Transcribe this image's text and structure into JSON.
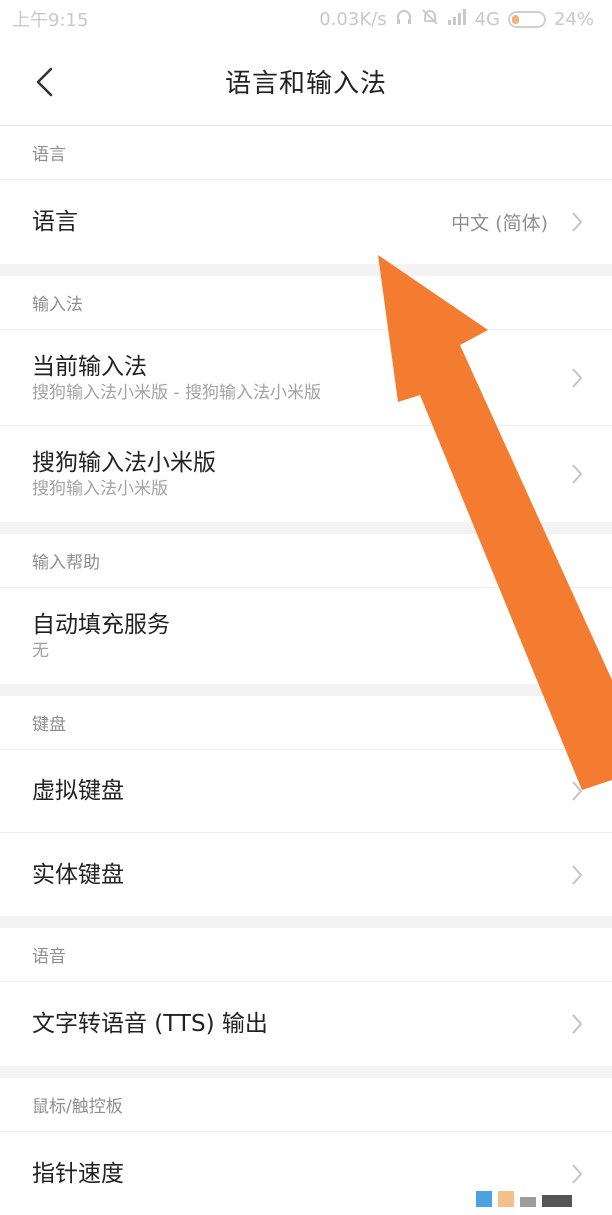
{
  "status_bar": {
    "time": "上午9:15",
    "net_speed": "0.03K/s",
    "network": "4G",
    "battery": "24%",
    "battery_level": 0.24
  },
  "header": {
    "title": "语言和输入法"
  },
  "sections": [
    {
      "header": "语言",
      "rows": [
        {
          "title": "语言",
          "value": "中文 (简体)"
        }
      ]
    },
    {
      "header": "输入法",
      "rows": [
        {
          "title": "当前输入法",
          "subtitle": "搜狗输入法小米版 - 搜狗输入法小米版"
        },
        {
          "title": "搜狗输入法小米版",
          "subtitle": "搜狗输入法小米版"
        }
      ]
    },
    {
      "header": "输入帮助",
      "rows": [
        {
          "title": "自动填充服务",
          "subtitle": "无"
        }
      ]
    },
    {
      "header": "键盘",
      "rows": [
        {
          "title": "虚拟键盘"
        },
        {
          "title": "实体键盘"
        }
      ]
    },
    {
      "header": "语音",
      "rows": [
        {
          "title": "文字转语音 (TTS) 输出"
        }
      ]
    },
    {
      "header": "鼠标/触控板",
      "rows": [
        {
          "title": "指针速度"
        }
      ]
    }
  ],
  "colors": {
    "arrow": "#f47c30",
    "section_gap": "#f3f3f3",
    "secondary_text": "#8f8f8f"
  }
}
